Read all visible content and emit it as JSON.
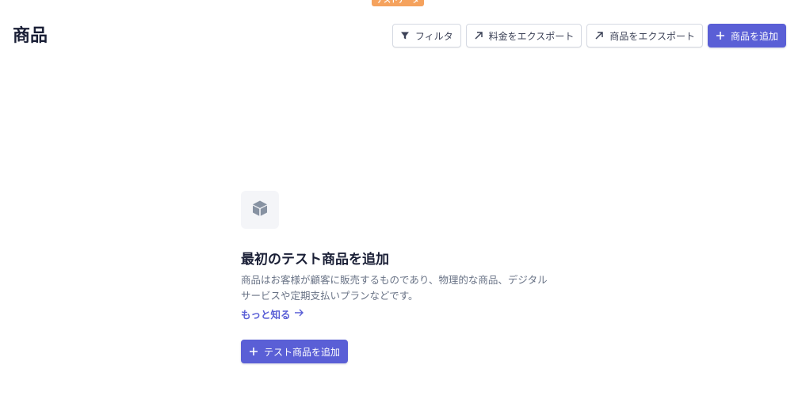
{
  "badge": {
    "test_data": "テストデータ"
  },
  "header": {
    "title": "商品"
  },
  "toolbar": {
    "filter_label": "フィルタ",
    "export_prices_label": "料金をエクスポート",
    "export_products_label": "商品をエクスポート",
    "add_product_label": "商品を追加"
  },
  "empty_state": {
    "icon": "box-icon",
    "title": "最初のテスト商品を追加",
    "description": "商品はお客様が顧客に販売するものであり、物理的な商品、デジタルサービスや定期支払いプランなどです。",
    "learn_more_label": "もっと知る",
    "cta_label": "テスト商品を追加"
  },
  "colors": {
    "primary": "#5a5fd6",
    "test_badge": "#f5a25d",
    "text": "#1a1f36",
    "muted": "#697386"
  }
}
